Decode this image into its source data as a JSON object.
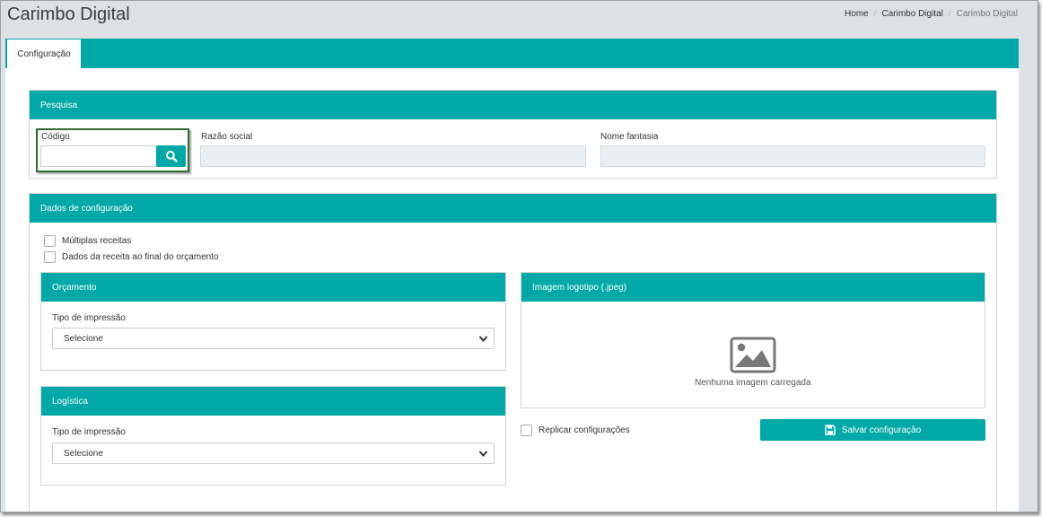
{
  "page": {
    "title": "Carimbo Digital"
  },
  "breadcrumb": {
    "items": [
      "Home",
      "Carimbo Digital",
      "Carimbo Digital"
    ],
    "separator": "/"
  },
  "tabs": [
    {
      "label": "Configuração",
      "active": true
    }
  ],
  "colors": {
    "accent": "#00a9a7",
    "highlight_border": "#2e6b2e",
    "background": "#dde1e6"
  },
  "search_panel": {
    "title": "Pesquisa",
    "codigo": {
      "label": "Código",
      "value": "",
      "icon": "search-icon"
    },
    "razao_social": {
      "label": "Razão social",
      "value": ""
    },
    "nome_fantasia": {
      "label": "Nome fantasia",
      "value": ""
    }
  },
  "config_panel": {
    "title": "Dados de configuração",
    "checkboxes": [
      {
        "label": "Múltiplas receitas",
        "checked": false
      },
      {
        "label": "Dados da receita ao final do orçamento",
        "checked": false
      }
    ],
    "orcamento": {
      "title": "Orçamento",
      "field_label": "Tipo de impressão",
      "selected": "Selecione"
    },
    "logistica": {
      "title": "Logística",
      "field_label": "Tipo de impressão",
      "selected": "Selecione"
    },
    "logo": {
      "title": "Imagem logotipo (.jpeg)",
      "placeholder_icon": "image-icon",
      "empty_text": "Nenhuma imagem carregada"
    },
    "replicar": {
      "label": "Replicar configurações",
      "checked": false
    },
    "save_button": {
      "label": "Salvar configuração",
      "icon": "floppy-disk-icon"
    }
  }
}
